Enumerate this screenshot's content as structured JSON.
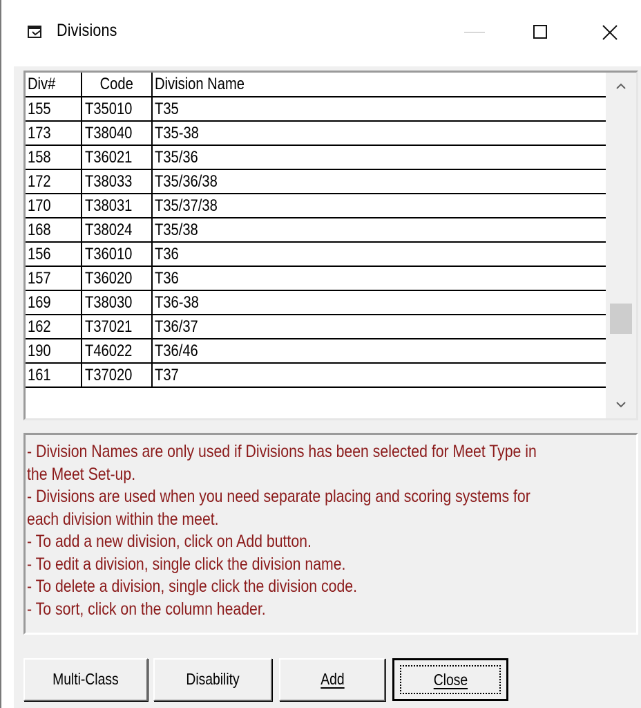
{
  "window": {
    "title": "Divisions",
    "icon": "window-app-icon",
    "controls": [
      "minimize-icon",
      "maximize-icon",
      "close-icon"
    ]
  },
  "grid": {
    "columns": [
      "Div#",
      "Code",
      "Division Name"
    ],
    "rows": [
      {
        "div": "155",
        "code": "T35010",
        "name": "T35"
      },
      {
        "div": "173",
        "code": "T38040",
        "name": "T35-38"
      },
      {
        "div": "158",
        "code": "T36021",
        "name": "T35/36"
      },
      {
        "div": "172",
        "code": "T38033",
        "name": "T35/36/38"
      },
      {
        "div": "170",
        "code": "T38031",
        "name": "T35/37/38"
      },
      {
        "div": "168",
        "code": "T38024",
        "name": "T35/38"
      },
      {
        "div": "156",
        "code": "T36010",
        "name": "T36"
      },
      {
        "div": "157",
        "code": "T36020",
        "name": "T36"
      },
      {
        "div": "169",
        "code": "T38030",
        "name": "T36-38"
      },
      {
        "div": "162",
        "code": "T37021",
        "name": "T36/37"
      },
      {
        "div": "190",
        "code": "T46022",
        "name": "T36/46"
      },
      {
        "div": "161",
        "code": "T37020",
        "name": "T37"
      }
    ]
  },
  "info": {
    "lines": [
      "- Division Names are only used if Divisions has been selected for Meet Type in",
      "the Meet Set-up.",
      "- Divisions are used when you need separate placing and scoring systems for",
      "each division within the meet.",
      "- To add a new division, click on Add button.",
      "- To edit a division, single click the division name.",
      "- To delete a division, single click the division code.",
      "- To sort, click on the column header."
    ],
    "text_color": "#8b1a1a"
  },
  "buttons": {
    "multiclass": "Multi-Class",
    "disability": "Disability",
    "add": "Add",
    "close": "Close"
  },
  "colors": {
    "header_text": "#0000ee",
    "background": "#f0f0f0"
  }
}
